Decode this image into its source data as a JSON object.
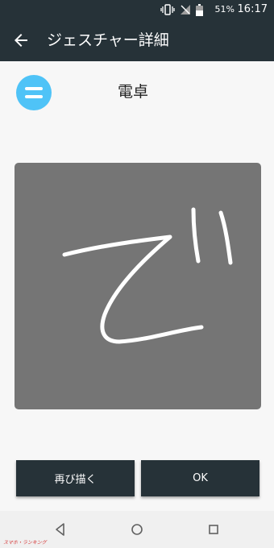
{
  "status_bar": {
    "battery_percent": "51%",
    "time": "16:17",
    "icons": [
      "vibrate-icon",
      "no-signal-icon",
      "battery-icon"
    ]
  },
  "app_bar": {
    "back_icon": "arrow-left-icon",
    "title": "ジェスチャー詳細"
  },
  "gesture": {
    "app_icon": "menu-icon",
    "app_icon_color": "#4fc3f7",
    "app_name": "電卓",
    "drawn_glyph": "で"
  },
  "buttons": {
    "redraw_label": "再び描く",
    "ok_label": "OK"
  },
  "nav_bar": {
    "icons": [
      "back-triangle-icon",
      "home-circle-icon",
      "recents-square-icon"
    ]
  },
  "colors": {
    "bar_background": "#263238",
    "canvas_background": "#757575",
    "stroke": "#ffffff"
  },
  "watermark": "スマホ・ランキング"
}
